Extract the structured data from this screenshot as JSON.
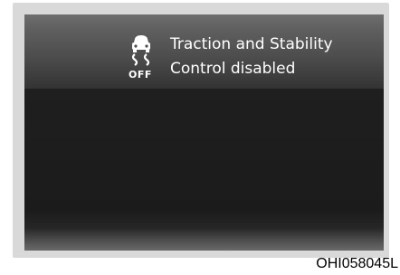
{
  "display": {
    "icon": "traction-control-off-icon",
    "icon_text": "OFF",
    "message_line1": "Traction and Stability",
    "message_line2": "Control disabled"
  },
  "caption": "OHI058045L"
}
